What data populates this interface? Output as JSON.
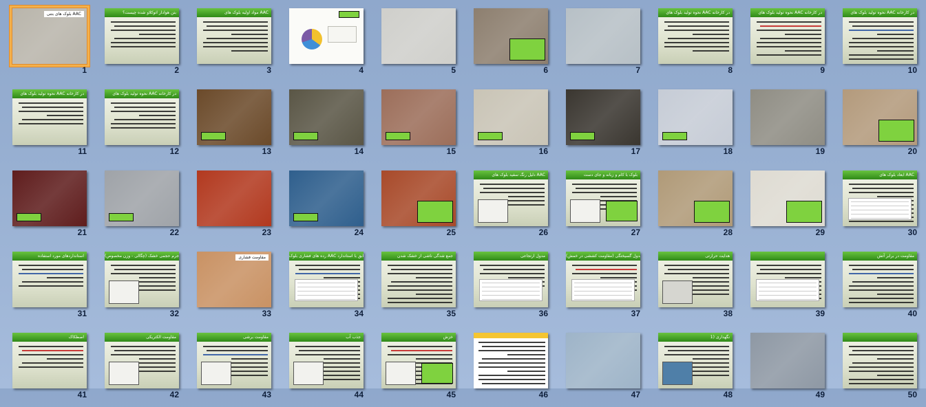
{
  "slides": [
    {
      "n": "1",
      "kind": "photo",
      "title": "بلوک های بتنی AAC",
      "bg": "#b9b5ab",
      "selected": true
    },
    {
      "n": "2",
      "kind": "text",
      "title": "بتن هوادار اتوکلاو شده چیست؟"
    },
    {
      "n": "3",
      "kind": "text",
      "title": "مواد اولیه بلوک های AAC"
    },
    {
      "n": "4",
      "kind": "diagram",
      "title": ""
    },
    {
      "n": "5",
      "kind": "photo",
      "title": "",
      "bg": "#cfcfcb"
    },
    {
      "n": "6",
      "kind": "photo",
      "title": "",
      "bg": "#8d7f6f"
    },
    {
      "n": "7",
      "kind": "photo",
      "title": "",
      "bg": "#b7c0c6"
    },
    {
      "n": "8",
      "kind": "text",
      "title": "نحوه تولید بلوک های AAC در کارخانه"
    },
    {
      "n": "9",
      "kind": "text",
      "title": "نحوه تولید بلوک های AAC در کارخانه"
    },
    {
      "n": "10",
      "kind": "text",
      "title": "نحوه تولید بلوک های AAC در کارخانه"
    },
    {
      "n": "11",
      "kind": "text",
      "title": "نحوه تولید بلوک های AAC در کارخانه"
    },
    {
      "n": "12",
      "kind": "text",
      "title": "نحوه تولید بلوک های AAC در کارخانه"
    },
    {
      "n": "13",
      "kind": "photo",
      "title": "",
      "bg": "#6b4a2a"
    },
    {
      "n": "14",
      "kind": "photo",
      "title": "",
      "bg": "#5a5646"
    },
    {
      "n": "15",
      "kind": "photo",
      "title": "",
      "bg": "#9c6e5a"
    },
    {
      "n": "16",
      "kind": "photo",
      "title": "",
      "bg": "#c9c4b6"
    },
    {
      "n": "17",
      "kind": "photo",
      "title": "",
      "bg": "#3a3630"
    },
    {
      "n": "18",
      "kind": "photo",
      "title": "",
      "bg": "#c6ccd6"
    },
    {
      "n": "19",
      "kind": "photo",
      "title": "",
      "bg": "#8f8d84"
    },
    {
      "n": "20",
      "kind": "photo",
      "title": "",
      "bg": "#b39a7c"
    },
    {
      "n": "21",
      "kind": "photo",
      "title": "",
      "bg": "#5f1d1d"
    },
    {
      "n": "22",
      "kind": "photo",
      "title": "",
      "bg": "#9fa3a8"
    },
    {
      "n": "23",
      "kind": "photo",
      "title": "",
      "bg": "#b2391f"
    },
    {
      "n": "24",
      "kind": "photo",
      "title": "",
      "bg": "#2f5f8d"
    },
    {
      "n": "25",
      "kind": "photo",
      "title": "",
      "bg": "#a84a2a"
    },
    {
      "n": "26",
      "kind": "text",
      "title": "دلیل رنگ سفید بلوک های AAC"
    },
    {
      "n": "27",
      "kind": "text",
      "title": "بلوک با کام و زبانه و جای دست"
    },
    {
      "n": "28",
      "kind": "photo",
      "title": "",
      "bg": "#b09a78"
    },
    {
      "n": "29",
      "kind": "photo",
      "title": "",
      "bg": "#dedbd2"
    },
    {
      "n": "30",
      "kind": "text",
      "title": "ابعاد بلوک های AAC"
    },
    {
      "n": "31",
      "kind": "text",
      "title": "استانداردهای مورد استفاده"
    },
    {
      "n": "32",
      "kind": "text",
      "title": "جرم حجمی خشک (چگالی - وزن مخصوص)"
    },
    {
      "n": "33",
      "kind": "photo",
      "title": "مقاومت فشاری",
      "bg": "#c99264"
    },
    {
      "n": "34",
      "kind": "text",
      "title": "رده های فشاری بلوک AAC مطابق با استاندارد ASTM ایران"
    },
    {
      "n": "35",
      "kind": "text",
      "title": "جمع شدگی ناشی از خشک شدن"
    },
    {
      "n": "36",
      "kind": "text",
      "title": "مدول ارتجاعی"
    },
    {
      "n": "37",
      "kind": "text",
      "title": "مدول گسیختگی (مقاومت کششی در خمش)"
    },
    {
      "n": "38",
      "kind": "text",
      "title": "هدایت حرارتی"
    },
    {
      "n": "39",
      "kind": "text",
      "title": ""
    },
    {
      "n": "40",
      "kind": "text",
      "title": "مقاومت در برابر آتش"
    },
    {
      "n": "41",
      "kind": "text",
      "title": "اصطکاک"
    },
    {
      "n": "42",
      "kind": "text",
      "title": "مقاومت الکتریکی"
    },
    {
      "n": "43",
      "kind": "text",
      "title": "مقاومت برشی"
    },
    {
      "n": "44",
      "kind": "text",
      "title": "جذب آب"
    },
    {
      "n": "45",
      "kind": "text",
      "title": "خزش"
    },
    {
      "n": "46",
      "kind": "doc",
      "title": ""
    },
    {
      "n": "47",
      "kind": "photo",
      "title": "",
      "bg": "#9eb4c8"
    },
    {
      "n": "48",
      "kind": "text",
      "title": "1) نگهداری"
    },
    {
      "n": "49",
      "kind": "photo",
      "title": "",
      "bg": "#8e98a4"
    },
    {
      "n": "50",
      "kind": "text",
      "title": ""
    }
  ],
  "colors": {
    "title_bar": "#3a9a1e",
    "highlight_box": "#7fd23f",
    "selection": "#e08a2c"
  }
}
